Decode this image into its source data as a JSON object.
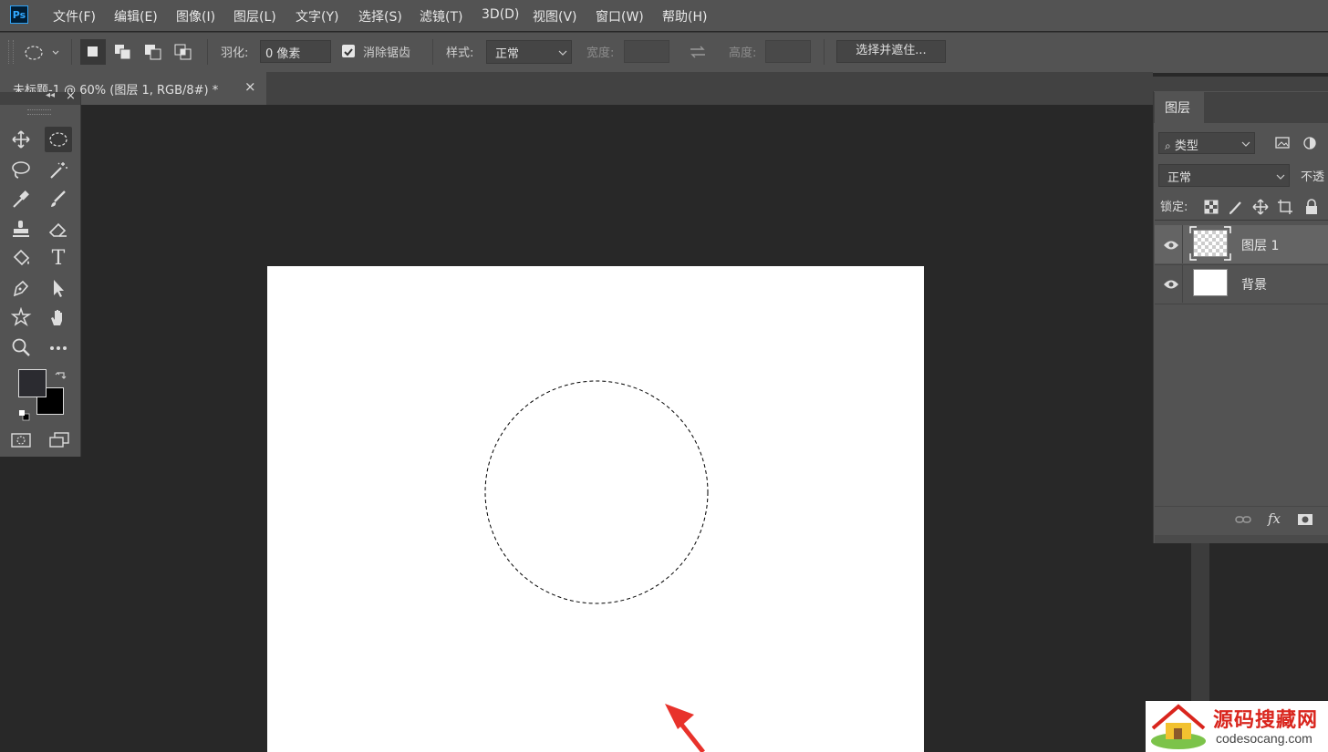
{
  "app": {
    "logo": "Ps"
  },
  "menu": [
    "文件(F)",
    "编辑(E)",
    "图像(I)",
    "图层(L)",
    "文字(Y)",
    "选择(S)",
    "滤镜(T)",
    "3D(D)",
    "视图(V)",
    "窗口(W)",
    "帮助(H)"
  ],
  "options": {
    "feather_label": "羽化:",
    "feather_value": "0 像素",
    "antialias_label": "消除锯齿",
    "antialias_checked": true,
    "style_label": "样式:",
    "style_value": "正常",
    "width_label": "宽度:",
    "height_label": "高度:",
    "select_mask_button": "选择并遮住..."
  },
  "document": {
    "tab_title": "未标题-1 @ 60% (图层 1, RGB/8#) *",
    "close_glyph": "×"
  },
  "toolbox": {
    "tools": [
      "move-tool",
      "elliptical-marquee-tool",
      "lasso-tool",
      "magic-wand-tool",
      "eyedropper-tool",
      "brush-tool",
      "clone-stamp-tool",
      "eraser-tool",
      "paint-bucket-tool",
      "type-tool",
      "pen-tool",
      "path-selection-tool",
      "custom-shape-tool",
      "hand-tool",
      "zoom-tool",
      "more-tools"
    ],
    "active_tool": "elliptical-marquee-tool",
    "type_glyph": "T",
    "foreground_color": "#2b2b30",
    "background_color": "#000000"
  },
  "layers_panel": {
    "tab_label": "图层",
    "filter_value": "类型",
    "blend_mode": "正常",
    "opacity_label": "不透",
    "lock_label": "锁定:",
    "fx_label": "fx",
    "layers": [
      {
        "name": "图层 1",
        "visible": true,
        "selected": true
      },
      {
        "name": "背景",
        "visible": true,
        "selected": false
      }
    ]
  },
  "watermark": {
    "title": "源码搜藏网",
    "url": "codesocang.com"
  },
  "colors": {
    "arrow": "#e8322b",
    "watermark_title": "#d9251d"
  }
}
